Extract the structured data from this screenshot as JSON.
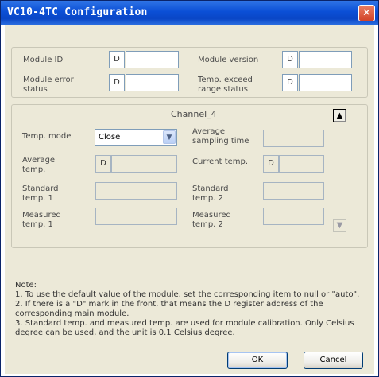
{
  "window": {
    "title": "VC10-4TC Configuration",
    "close_glyph": "✕"
  },
  "module": {
    "id_label": "Module ID",
    "id_prefix": "D",
    "version_label": "Module version",
    "version_prefix": "D",
    "error_label": "Module error status",
    "error_prefix": "D",
    "range_label": "Temp. exceed range status",
    "range_prefix": "D"
  },
  "channel": {
    "title": "Channel_4",
    "temp_mode_label": "Temp. mode",
    "temp_mode_value": "Close",
    "avg_sampling_label": "Average sampling time",
    "avg_temp_label": "Average temp.",
    "avg_temp_prefix": "D",
    "current_temp_label": "Current temp.",
    "current_temp_prefix": "D",
    "std_temp1_label": "Standard temp. 1",
    "std_temp2_label": "Standard temp. 2",
    "meas_temp1_label": "Measured temp. 1",
    "meas_temp2_label": "Measured temp. 2",
    "up_glyph": "▲",
    "down_glyph": "▼"
  },
  "notes": {
    "heading": "Note:",
    "line1": "1. To use the default value of the module, set the corresponding item to null or \"auto\".",
    "line2": "2. If there is a \"D\" mark in the front, that means the D register address of the corresponding main module.",
    "line3": "3. Standard temp. and measured temp. are used for module calibration. Only Celsius degree can be used, and the unit is 0.1 Celsius degree."
  },
  "buttons": {
    "ok": "OK",
    "cancel": "Cancel"
  }
}
